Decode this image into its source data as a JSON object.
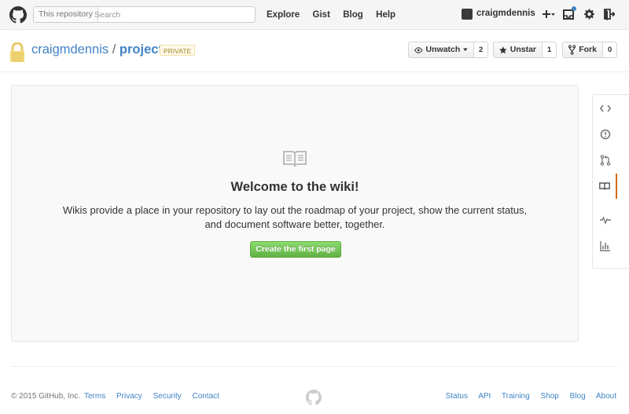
{
  "header": {
    "search_scope": "This repository",
    "search_placeholder": "Search",
    "nav": [
      "Explore",
      "Gist",
      "Blog",
      "Help"
    ],
    "username": "craigmdennis"
  },
  "repo": {
    "owner": "craigmdennis",
    "separator": "/",
    "name": "project",
    "visibility": "PRIVATE",
    "unwatch_label": "Unwatch",
    "watch_count": "2",
    "unstar_label": "Unstar",
    "star_count": "1",
    "fork_label": "Fork",
    "fork_count": "0"
  },
  "wiki": {
    "title": "Welcome to the wiki!",
    "description": "Wikis provide a place in your repository to lay out the roadmap of your project, show the current status, and document software better, together.",
    "create_button": "Create the first page"
  },
  "sidenav": {
    "items": [
      "code-icon",
      "issues-icon",
      "pull-requests-icon",
      "wiki-icon",
      "pulse-icon",
      "graphs-icon"
    ],
    "selected": "wiki-icon",
    "accent_color": "#d26911"
  },
  "footer": {
    "copyright": "© 2015 GitHub, Inc.",
    "left_links": [
      "Terms",
      "Privacy",
      "Security",
      "Contact"
    ],
    "right_links": [
      "Status",
      "API",
      "Training",
      "Shop",
      "Blog",
      "About"
    ]
  },
  "colors": {
    "link": "#4183c4",
    "primary_button": "#60b044",
    "private_label": "#a1882b"
  }
}
